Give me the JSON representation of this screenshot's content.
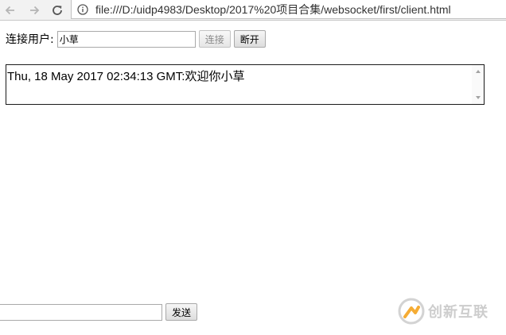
{
  "browser": {
    "back_icon": "back-arrow-icon",
    "forward_icon": "forward-arrow-icon",
    "reload_icon": "reload-icon",
    "info_icon": "info-icon",
    "url": "file:///D:/uidp4983/Desktop/2017%20项目合集/websocket/first/client.html"
  },
  "connect_form": {
    "label": "连接用户:",
    "username_value": "小草",
    "connect_label": "连接",
    "disconnect_label": "断开"
  },
  "messages": {
    "lines": [
      "Thu, 18 May 2017 02:34:13 GMT:欢迎你小草"
    ]
  },
  "send_form": {
    "input_value": "",
    "send_label": "发送"
  },
  "watermark": {
    "text": "创新互联",
    "logo_icon": "brand-logo-icon"
  },
  "colors": {
    "watermark_orange": "#f5a623",
    "watermark_gray": "#c9c9c9"
  }
}
